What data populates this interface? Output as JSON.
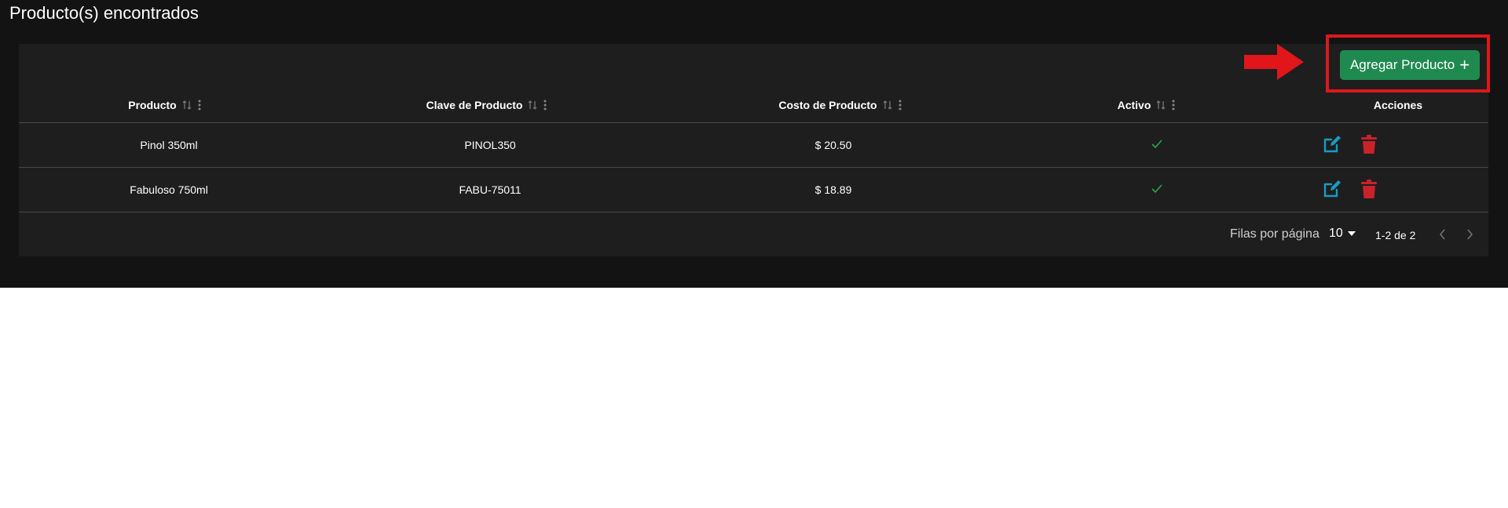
{
  "page": {
    "title": "Producto(s) encontrados"
  },
  "toolbar": {
    "add_label": "Agregar Producto"
  },
  "table": {
    "columns": [
      "Producto",
      "Clave de Producto",
      "Costo de Producto",
      "Activo",
      "Acciones"
    ],
    "rows": [
      {
        "producto": "Pinol 350ml",
        "clave": "PINOL350",
        "costo": "$ 20.50",
        "activo": true
      },
      {
        "producto": "Fabuloso 750ml",
        "clave": "FABU-75011",
        "costo": "$ 18.89",
        "activo": true
      }
    ]
  },
  "pagination": {
    "rows_per_page_label": "Filas por página",
    "rows_per_page_value": "10",
    "range": "1-2 de 2"
  },
  "colors": {
    "background": "#131313",
    "card": "#1e1e1e",
    "accent_green": "#1f8a50",
    "highlight_red": "#e0161b",
    "edit_blue": "#1a9bc2",
    "delete_red": "#c9222a",
    "check_green": "#2ea44f"
  },
  "icons": [
    "sort-icon",
    "column-menu-icon",
    "check-icon",
    "edit-icon",
    "trash-icon",
    "dropdown-caret-icon",
    "chevron-left-icon",
    "chevron-right-icon",
    "red-arrow-icon"
  ]
}
